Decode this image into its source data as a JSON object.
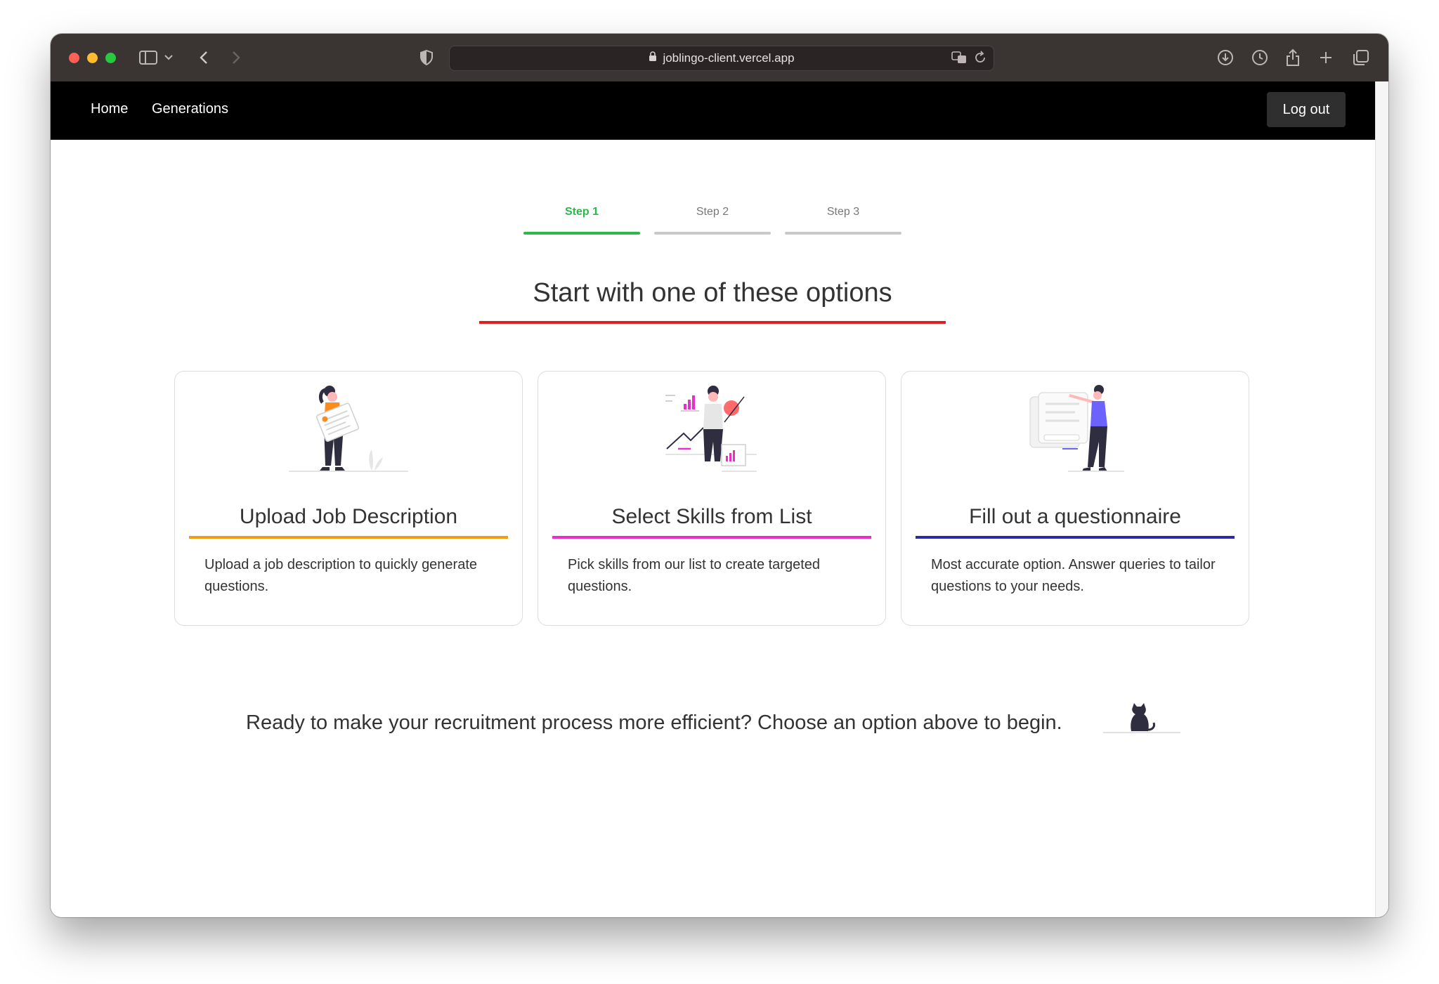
{
  "browser": {
    "url": "joblingo-client.vercel.app"
  },
  "nav": {
    "home": "Home",
    "generations": "Generations",
    "logout": "Log out"
  },
  "stepper": {
    "steps": [
      "Step 1",
      "Step 2",
      "Step 3"
    ],
    "active_index": 0,
    "active_color": "#2eb84b"
  },
  "heading": "Start with one of these options",
  "cards": [
    {
      "title": "Upload Job Description",
      "description": "Upload a job description to quickly generate questions.",
      "accent": "#f39c12",
      "icon": "woman-holding-document-illustration"
    },
    {
      "title": "Select Skills from List",
      "description": "Pick skills from our list to create targeted questions.",
      "accent": "#e92fc8",
      "icon": "woman-with-charts-illustration"
    },
    {
      "title": "Fill out a questionnaire",
      "description": "Most accurate option. Answer queries to tailor questions to your needs.",
      "accent": "#2a2aa6",
      "icon": "woman-pointing-at-form-illustration"
    }
  ],
  "footer": {
    "text": "Ready to make your recruitment process more efficient? Choose an option above to begin.",
    "icon": "cat-illustration"
  }
}
